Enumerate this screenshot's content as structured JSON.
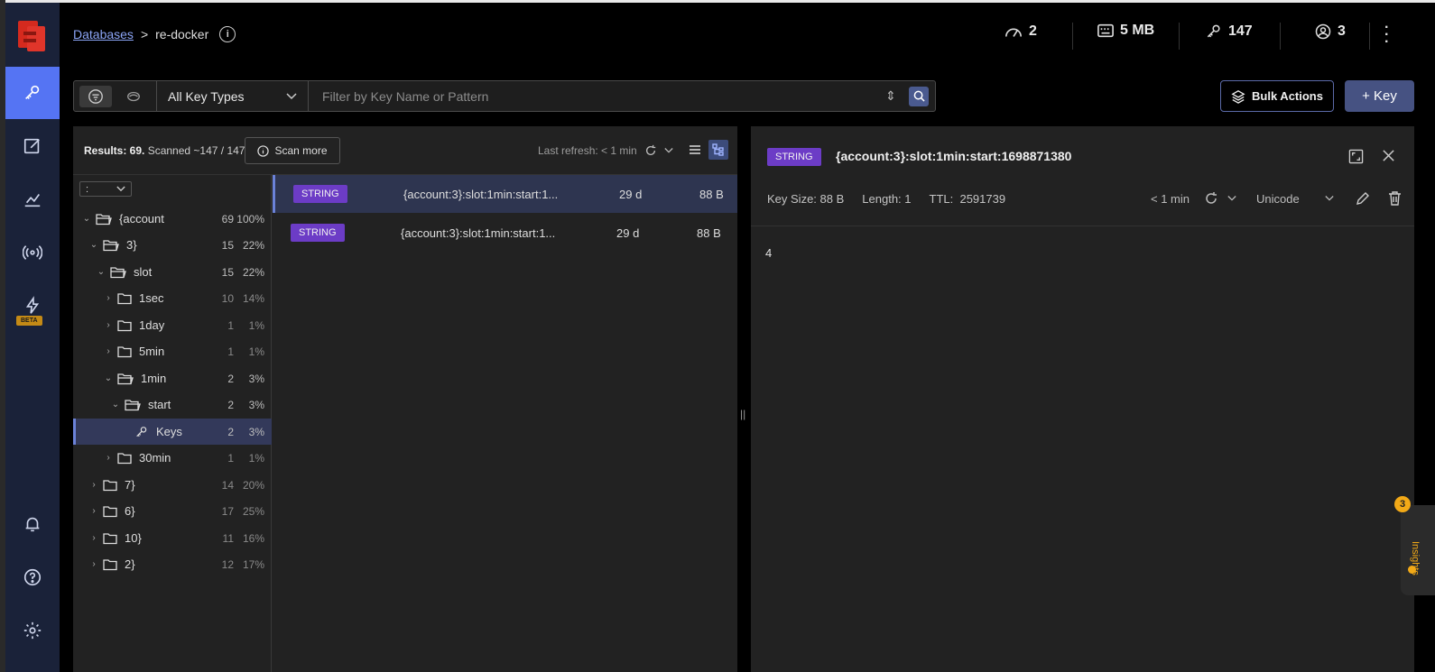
{
  "colors": {
    "sidebar_bg": "#1a2239",
    "accent": "#5574f3",
    "string_badge": "#6c3cc6",
    "panel_bg": "#222222"
  },
  "breadcrumb": {
    "databases": "Databases",
    "separator": ">",
    "db_name": "re-docker",
    "info_icon": "i"
  },
  "header_stats": {
    "cpu": {
      "icon": "gauge-icon",
      "value": "2"
    },
    "memory": {
      "icon": "memory-icon",
      "value": "5 MB"
    },
    "keys": {
      "icon": "key-icon",
      "value": "147"
    },
    "clients": {
      "icon": "user-icon",
      "value": "3"
    }
  },
  "sidebar": {
    "items": [
      {
        "name": "browser",
        "icon": "key-icon",
        "active": true
      },
      {
        "name": "workbench",
        "icon": "edit-icon"
      },
      {
        "name": "analysis",
        "icon": "chart-icon"
      },
      {
        "name": "pubsub",
        "icon": "broadcast-icon"
      },
      {
        "name": "triggers",
        "icon": "lightning-icon",
        "badge": "BETA"
      }
    ],
    "bottom": [
      {
        "name": "notifications",
        "icon": "bell-icon"
      },
      {
        "name": "help",
        "icon": "help-icon"
      },
      {
        "name": "settings",
        "icon": "gear-icon"
      }
    ],
    "beta_label": "BETA"
  },
  "filter": {
    "key_type": "All Key Types",
    "placeholder": "Filter by Key Name or Pattern"
  },
  "actions": {
    "bulk": "Bulk Actions",
    "add_key": "+ Key"
  },
  "results": {
    "label": "Results: 69.",
    "scanned": "Scanned ~147 / 147",
    "scan_more": "Scan more",
    "last_refresh": "Last refresh: < 1 min"
  },
  "tree": {
    "delimiter": ":",
    "rows": [
      {
        "name": "{account",
        "count": "69",
        "pct": "100%",
        "expanded": true
      },
      {
        "name": "3}",
        "count": "15",
        "pct": "22%",
        "expanded": true
      },
      {
        "name": "slot",
        "count": "15",
        "pct": "22%",
        "expanded": true
      },
      {
        "name": "1sec",
        "count": "10",
        "pct": "14%"
      },
      {
        "name": "1day",
        "count": "1",
        "pct": "1%"
      },
      {
        "name": "5min",
        "count": "1",
        "pct": "1%"
      },
      {
        "name": "1min",
        "count": "2",
        "pct": "3%",
        "expanded": true
      },
      {
        "name": "start",
        "count": "2",
        "pct": "3%",
        "expanded": true
      },
      {
        "name": "Keys",
        "count": "2",
        "pct": "3%",
        "selected": true
      },
      {
        "name": "30min",
        "count": "1",
        "pct": "1%"
      },
      {
        "name": "7}",
        "count": "14",
        "pct": "20%"
      },
      {
        "name": "6}",
        "count": "17",
        "pct": "25%"
      },
      {
        "name": "10}",
        "count": "11",
        "pct": "16%"
      },
      {
        "name": "2}",
        "count": "12",
        "pct": "17%"
      }
    ]
  },
  "keys": [
    {
      "type": "STRING",
      "name": "{account:3}:slot:1min:start:1...",
      "ttl": "29 d",
      "size": "88 B",
      "selected": true
    },
    {
      "type": "STRING",
      "name": "{account:3}:slot:1min:start:1...",
      "ttl": "29 d",
      "size": "88 B"
    }
  ],
  "details": {
    "type": "STRING",
    "key_name": "{account:3}:slot:1min:start:1698871380",
    "key_size": "Key Size: 88 B",
    "length": "Length: 1",
    "ttl_label": "TTL:",
    "ttl_value": "2591739",
    "refresh": "< 1 min",
    "format": "Unicode",
    "value": "4"
  },
  "insights": {
    "count": "3",
    "label": "Insights"
  }
}
